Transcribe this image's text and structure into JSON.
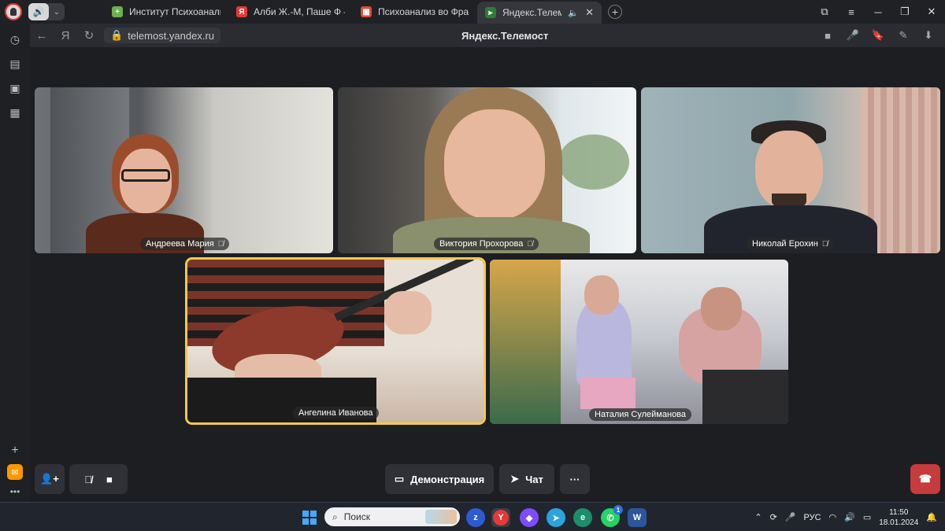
{
  "browser": {
    "tabs": [
      {
        "label": "Институт Психоанализа н",
        "fav_color": "#6ab04c",
        "fav": "+"
      },
      {
        "label": "Алби Ж.-М, Паше Ф — Ян",
        "fav_color": "#e53935",
        "fav": "Я"
      },
      {
        "label": "Психоанализ во Франци",
        "fav_color": "#e34a33",
        "fav": "▦"
      },
      {
        "label": "Яндекс.Телемост",
        "fav_color": "#2e7d32",
        "fav": "▸"
      }
    ],
    "url": "telemost.yandex.ru",
    "page_title": "Яндекс.Телемост"
  },
  "participants": [
    {
      "name": "Андреева Мария"
    },
    {
      "name": "Виктория Прохорова"
    },
    {
      "name": "Николай Ерохин"
    },
    {
      "name": "Ангелина Иванова"
    },
    {
      "name": "Наталия Сулейманова"
    }
  ],
  "controls": {
    "demo_label": "Демонстрация",
    "chat_label": "Чат",
    "more_label": "···"
  },
  "taskbar": {
    "search_placeholder": "Поиск",
    "lang": "РУС",
    "time": "11:50",
    "date": "18.01.2024",
    "whatsapp_badge": "1"
  },
  "colors": {
    "active_speaker": "#f5c84b",
    "leave": "#c73b3b"
  }
}
